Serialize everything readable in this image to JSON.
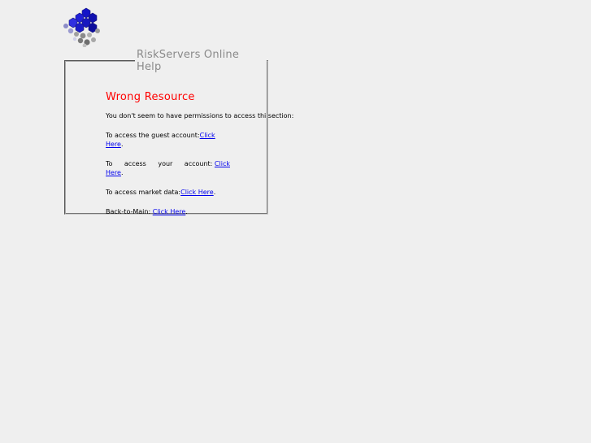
{
  "header": {
    "logo": "hexagon-molecule-logo"
  },
  "help_box": {
    "legend": "RiskServers Online Help",
    "title": "Wrong Resource",
    "intro": "You don't seem to have  permissions to access thi section:",
    "guest": {
      "label": "To access the guest account:",
      "link": "Click Here",
      "suffix": "."
    },
    "account": {
      "word1": "To",
      "word2": "access",
      "word3": "your",
      "word4": "account:",
      "link_part1": "Click",
      "link_part2": "Here",
      "suffix": "."
    },
    "market": {
      "label": "To access market data:",
      "link": "Click Here",
      "suffix": "."
    },
    "main": {
      "label": "Back-to-Main: ",
      "link": "Click Here",
      "suffix": "."
    }
  },
  "colors": {
    "background": "#efefef",
    "title": "#ff0000",
    "link": "#0000ee",
    "legend": "#8a8a8a"
  }
}
